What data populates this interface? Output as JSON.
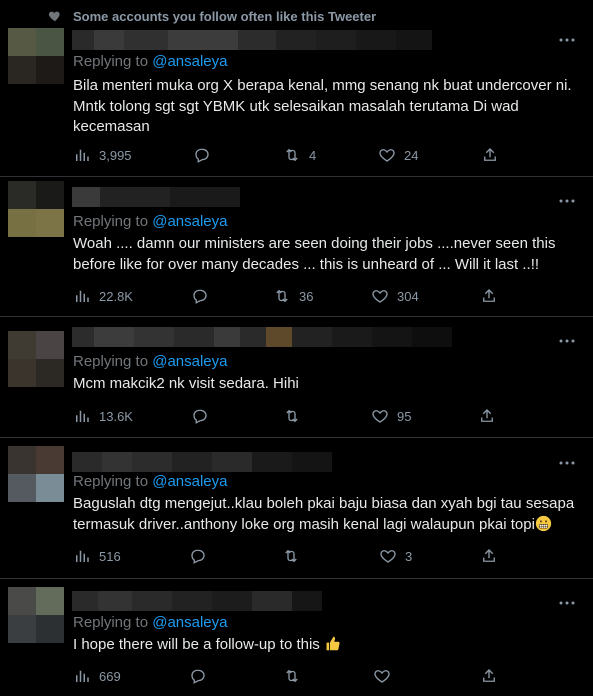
{
  "social_context": {
    "text": "Some accounts you follow often like this Tweeter"
  },
  "tweets": [
    {
      "replying_prefix": "Replying to",
      "handle": "@ansaleya",
      "lines": [
        "Bila menteri muka org X berapa kenal, mmg senang nk buat undercover ni.",
        "Mntk tolong sgt sgt YBMK utk selesaikan masalah terutama Di wad",
        "kecemasan"
      ],
      "views": "3,995",
      "retweets": "4",
      "likes": "24"
    },
    {
      "replying_prefix": "Replying to",
      "handle": "@ansaleya",
      "lines": [
        "Woah .... damn our ministers are seen doing their jobs ....never seen this",
        "before like for over many decades ... this is unheard of ... Will it last ..!!"
      ],
      "views": "22.8K",
      "retweets": "36",
      "likes": "304"
    },
    {
      "replying_prefix": "Replying to",
      "handle": "@ansaleya",
      "lines": [
        "Mcm makcik2 nk visit sedara. Hihi"
      ],
      "views": "13.6K",
      "retweets": "",
      "likes": "95"
    },
    {
      "replying_prefix": "Replying to",
      "handle": "@ansaleya",
      "lines": [
        "Baguslah dtg mengejut..klau boleh pkai baju biasa dan xyah bgi tau sesapa",
        "termasuk driver..anthony loke org masih kenal lagi walaupun pkai topi"
      ],
      "views": "516",
      "retweets": "",
      "likes": "3"
    },
    {
      "replying_prefix": "Replying to",
      "handle": "@ansaleya",
      "lines": [
        "I hope there will be a follow-up to this"
      ],
      "views": "669",
      "retweets": "",
      "likes": ""
    }
  ],
  "colors": {
    "background": "#000000",
    "link": "#1d9bf0",
    "muted": "#71767b",
    "text": "#e7e9ea"
  },
  "icons": [
    "heart-icon",
    "more-icon",
    "views-icon",
    "reply-icon",
    "retweet-icon",
    "like-icon",
    "share-icon",
    "grin-emoji",
    "thumbs-up-emoji"
  ]
}
